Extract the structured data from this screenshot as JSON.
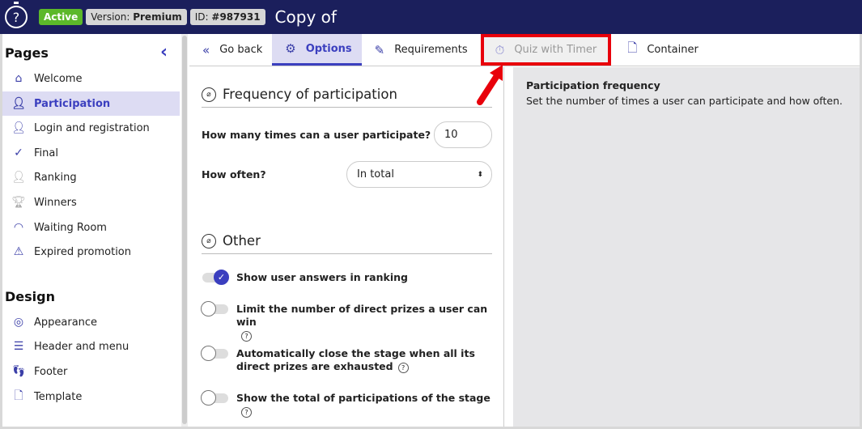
{
  "header": {
    "status": "Active",
    "version_label": "Version:",
    "version": "Premium",
    "id_label": "ID:",
    "id": "#987931",
    "title": "Copy of"
  },
  "sidebar": {
    "pages_title": "Pages",
    "pages": [
      {
        "label": "Welcome",
        "icon": "home-icon"
      },
      {
        "label": "Participation",
        "icon": "user-icon",
        "active": true
      },
      {
        "label": "Login and registration",
        "icon": "user-plus-icon"
      },
      {
        "label": "Final",
        "icon": "check-icon"
      },
      {
        "label": "Ranking",
        "icon": "ranking-icon"
      },
      {
        "label": "Winners",
        "icon": "trophy-icon"
      },
      {
        "label": "Waiting Room",
        "icon": "gauge-icon"
      },
      {
        "label": "Expired promotion",
        "icon": "warning-icon"
      }
    ],
    "design_title": "Design",
    "design": [
      {
        "label": "Appearance",
        "icon": "palette-icon"
      },
      {
        "label": "Header and menu",
        "icon": "menu-icon"
      },
      {
        "label": "Footer",
        "icon": "footer-icon"
      },
      {
        "label": "Template",
        "icon": "file-icon"
      }
    ]
  },
  "tabs": [
    {
      "label": "Go back",
      "icon": "double-chevron-left-icon"
    },
    {
      "label": "Options",
      "icon": "gear-icon",
      "active": true
    },
    {
      "label": "Requirements",
      "icon": "stamp-icon"
    },
    {
      "label": "Quiz with Timer",
      "icon": "stopwatch-icon",
      "highlighted": true
    },
    {
      "label": "Container",
      "icon": "file-icon"
    }
  ],
  "frequency": {
    "title": "Frequency of participation",
    "times_label": "How many times can a user participate?",
    "times_value": "10",
    "often_label": "How often?",
    "often_value": "In total"
  },
  "other": {
    "title": "Other",
    "options": [
      {
        "label": "Show user answers in ranking",
        "on": true,
        "help": false
      },
      {
        "label": "Limit the number of direct prizes a user can win",
        "on": false,
        "help": true
      },
      {
        "label": "Automatically close the stage when all its direct prizes are exhausted",
        "on": false,
        "help": true
      },
      {
        "label": "Show the total of participations of the stage",
        "on": false,
        "help": true
      }
    ]
  },
  "help_panel": {
    "title": "Participation frequency",
    "text": "Set the number of times a user can participate and how often."
  },
  "colors": {
    "header": "#1b1f5c",
    "accent": "#3b3fbf",
    "active_badge": "#5cb82a",
    "highlight": "#e8000b"
  }
}
